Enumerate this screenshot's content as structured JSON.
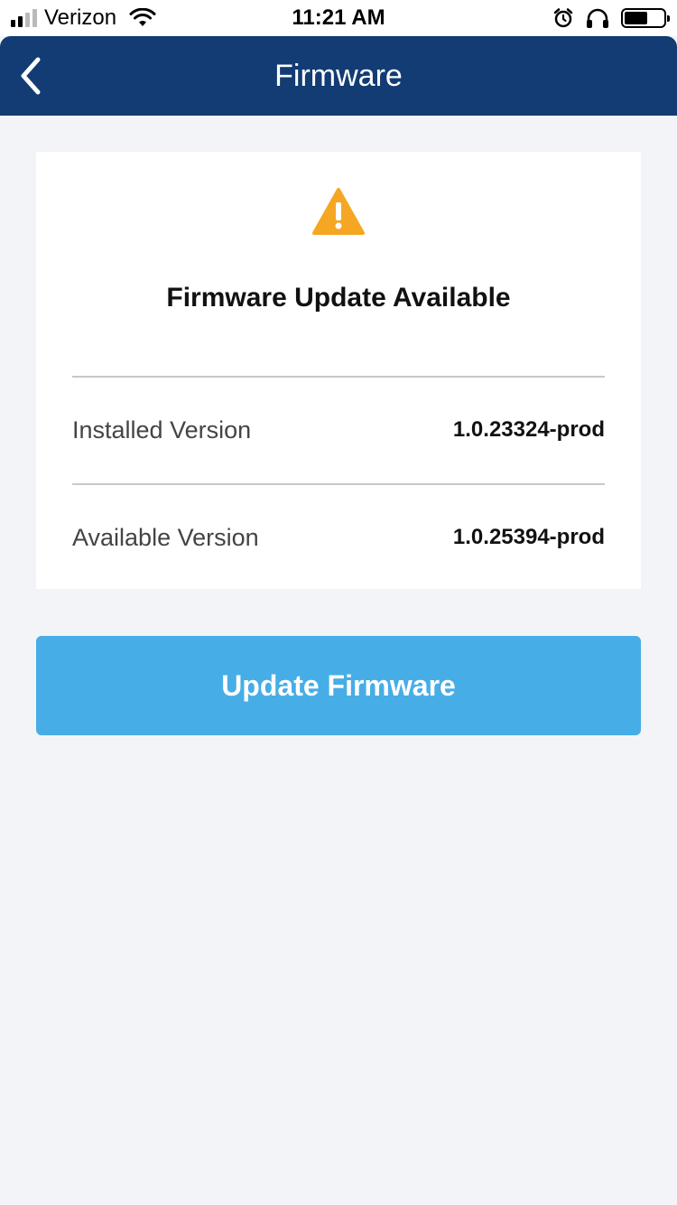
{
  "status_bar": {
    "carrier": "Verizon",
    "time": "11:21 AM",
    "signal_bars_filled": 2,
    "signal_bars_total": 4,
    "battery_level": 0.62,
    "icons": [
      "wifi-icon",
      "alarm-icon",
      "headphones-icon",
      "battery-icon"
    ]
  },
  "nav": {
    "title": "Firmware",
    "back_icon": "chevron-left-icon"
  },
  "card": {
    "icon": "warning-icon",
    "title": "Firmware Update Available",
    "rows": [
      {
        "label": "Installed Version",
        "value": "1.0.23324-prod"
      },
      {
        "label": "Available Version",
        "value": "1.0.25394-prod"
      }
    ]
  },
  "actions": {
    "update_label": "Update Firmware"
  },
  "colors": {
    "nav_background": "#123c73",
    "page_background": "#f2f4f8",
    "button_background": "#47ade6",
    "warning": "#f5a623"
  }
}
